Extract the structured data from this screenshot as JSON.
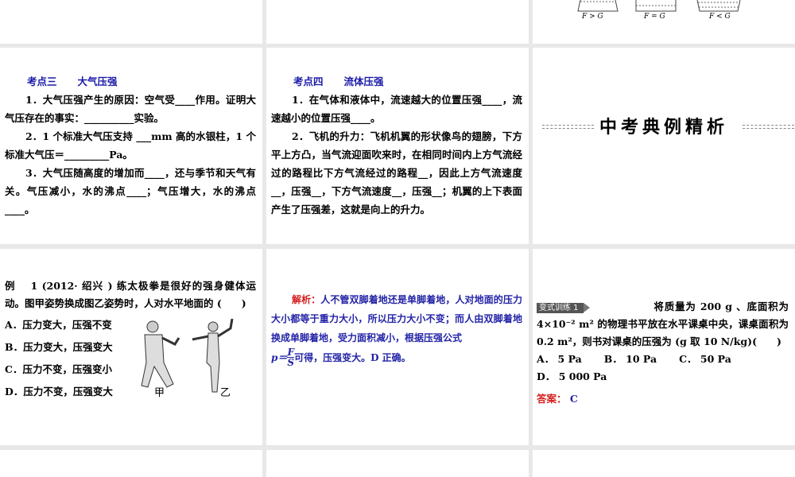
{
  "slide_top_right": {
    "labels": [
      "F > G",
      "F = G",
      "F < G"
    ]
  },
  "slide_kaodian3": {
    "heading_num": "考点三",
    "heading_title": "大气压强",
    "p1": "1．大气压强产生的原因：空气受____作用。证明大气压存在的事实：__________实验。",
    "p2": "2．1 个标准大气压支持 ___mm 高的水银柱，1 个标准大气压＝_________Pa。",
    "p3": "3．大气压随高度的增加而____，还与季节和天气有关。气压减小，水的沸点____；气压增大，水的沸点____。"
  },
  "slide_kaodian4": {
    "heading_num": "考点四",
    "heading_title": "流体压强",
    "p1": "1．在气体和液体中，流速越大的位置压强____，流速越小的位置压强____。",
    "p2": "2．飞机的升力：飞机机翼的形状像鸟的翅膀，下方平上方凸，当气流迎面吹来时，在相同时间内上方气流经过的路程比下方气流经过的路程__，因此上方气流速度__，压强__，下方气流速度__，压强__；机翼的上下表面产生了压强差，这就是向上的升力。"
  },
  "slide_title": {
    "title": "中考典例精析"
  },
  "slide_example": {
    "question": "例　 1 (2012· 绍兴 ) 练太极拳是很好的强身健体运动。图甲姿势换成图乙姿势时，人对水平地面的 (　　)",
    "options": [
      "A．压力变大，压强不变",
      "B．压力变大，压强变大",
      "C．压力不变，压强变小",
      "D．压力不变，压强变大"
    ],
    "fig_labels": [
      "甲",
      "乙"
    ]
  },
  "slide_analysis": {
    "label": "解析：",
    "text": "人不管双脚着地还是单脚着地，人对地面的压力大小都等于重力大小，所以压力大小不变；而人由双脚着地换成单脚着地，受力面积减小，根据压强公式",
    "formula_p": "p＝",
    "formula_num": "F",
    "formula_den": "S",
    "tail": "可得，压强变大。D 正确。"
  },
  "slide_practice": {
    "badge": "变式训练 1",
    "question_line1": "将质量为 200 g 、底面积为",
    "question_rest": "4×10⁻² m² 的物理书平放在水平课桌中央，课桌面积为 0.2 m²，则书对课桌的压强为 (g 取 10 N/kg)(　　)",
    "options": [
      "A． 5 Pa",
      "B． 10 Pa",
      "C． 50 Pa",
      "D． 5 000 Pa"
    ],
    "answer_label": "答案：",
    "answer": "C"
  }
}
